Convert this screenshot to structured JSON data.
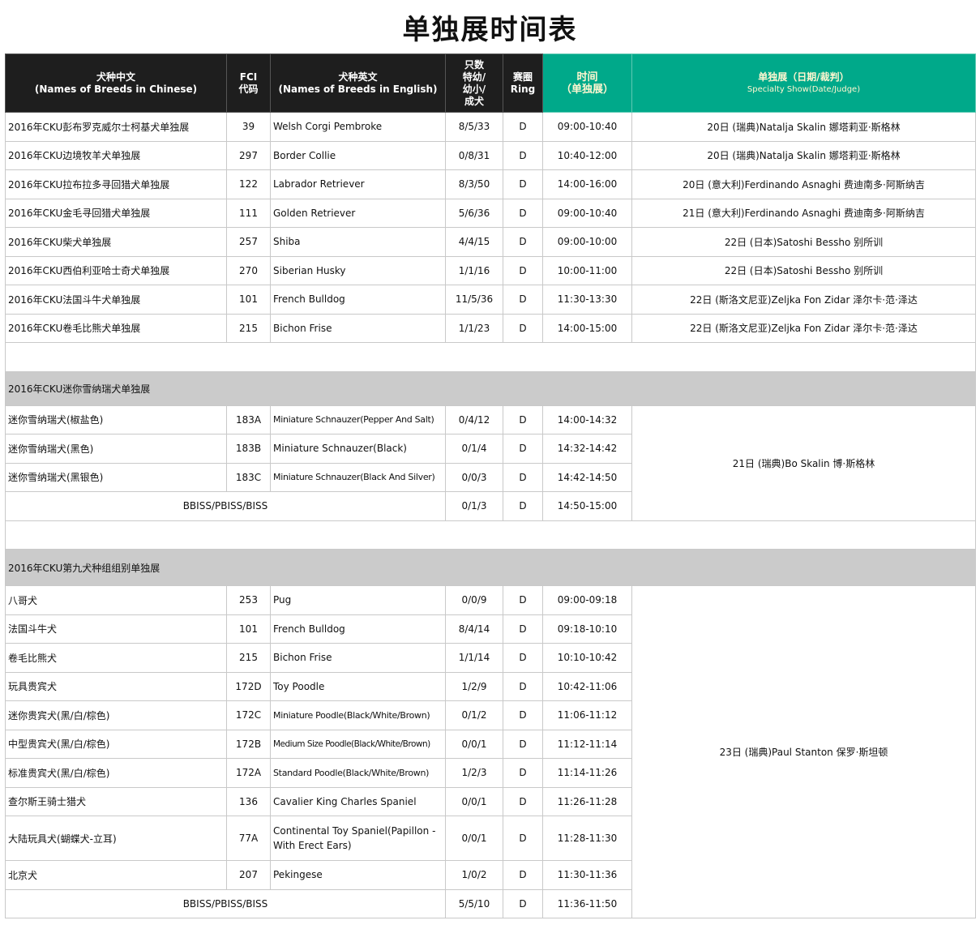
{
  "title": "单独展时间表",
  "header": {
    "breed_cn": "犬种中文",
    "breed_cn_en": "(Names of Breeds in Chinese)",
    "fci": "FCI",
    "fci_code": "代码",
    "breed_en": "犬种英文",
    "breed_en_en": "(Names of Breeds in English)",
    "count_1": "只数",
    "count_2": "特幼/",
    "count_3": "幼小/",
    "count_4": "成犬",
    "ring_cn": "赛圈",
    "ring_en": "Ring",
    "time_cn": "时间",
    "time_sub": "（单独展）",
    "show_cn": "单独展（日期/裁判）",
    "show_en": "Specialty Show(Date/Judge)"
  },
  "section1": {
    "rows": [
      {
        "cn": "2016年CKU彭布罗克威尔士柯基犬单独展",
        "fci": "39",
        "en": "Welsh Corgi Pembroke",
        "count": "8/5/33",
        "ring": "D",
        "time": "09:00-10:40",
        "judge": "20日 (瑞典)Natalja Skalin 娜塔莉亚·斯格林"
      },
      {
        "cn": "2016年CKU边境牧羊犬单独展",
        "fci": "297",
        "en": "Border Collie",
        "count": "0/8/31",
        "ring": "D",
        "time": "10:40-12:00",
        "judge": "20日 (瑞典)Natalja Skalin 娜塔莉亚·斯格林"
      },
      {
        "cn": "2016年CKU拉布拉多寻回猎犬单独展",
        "fci": "122",
        "en": "Labrador Retriever",
        "count": "8/3/50",
        "ring": "D",
        "time": "14:00-16:00",
        "judge": "20日 (意大利)Ferdinando Asnaghi 费迪南多·阿斯纳吉"
      },
      {
        "cn": "2016年CKU金毛寻回猎犬单独展",
        "fci": "111",
        "en": "Golden Retriever",
        "count": "5/6/36",
        "ring": "D",
        "time": "09:00-10:40",
        "judge": "21日 (意大利)Ferdinando Asnaghi 费迪南多·阿斯纳吉"
      },
      {
        "cn": "2016年CKU柴犬单独展",
        "fci": "257",
        "en": "Shiba",
        "count": "4/4/15",
        "ring": "D",
        "time": "09:00-10:00",
        "judge": "22日 (日本)Satoshi Bessho 别所训"
      },
      {
        "cn": "2016年CKU西伯利亚哈士奇犬单独展",
        "fci": "270",
        "en": "Siberian Husky",
        "count": "1/1/16",
        "ring": "D",
        "time": "10:00-11:00",
        "judge": "22日 (日本)Satoshi Bessho 别所训"
      },
      {
        "cn": "2016年CKU法国斗牛犬单独展",
        "fci": "101",
        "en": "French Bulldog",
        "count": "11/5/36",
        "ring": "D",
        "time": "11:30-13:30",
        "judge": "22日 (斯洛文尼亚)Zeljka Fon Zidar 泽尔卡·范·泽达"
      },
      {
        "cn": "2016年CKU卷毛比熊犬单独展",
        "fci": "215",
        "en": "Bichon Frise",
        "count": "1/1/23",
        "ring": "D",
        "time": "14:00-15:00",
        "judge": "22日 (斯洛文尼亚)Zeljka Fon Zidar 泽尔卡·范·泽达"
      }
    ]
  },
  "section2": {
    "title": "2016年CKU迷你雪纳瑞犬单独展",
    "judge": "21日 (瑞典)Bo Skalin 博·斯格林",
    "rows": [
      {
        "cn": "迷你雪纳瑞犬(椒盐色)",
        "fci": "183A",
        "en": "Miniature Schnauzer(Pepper And Salt)",
        "count": "0/4/12",
        "ring": "D",
        "time": "14:00-14:32"
      },
      {
        "cn": "迷你雪纳瑞犬(黑色)",
        "fci": "183B",
        "en": "Miniature Schnauzer(Black)",
        "count": "0/1/4",
        "ring": "D",
        "time": "14:32-14:42"
      },
      {
        "cn": "迷你雪纳瑞犬(黑银色)",
        "fci": "183C",
        "en": "Miniature Schnauzer(Black And Silver)",
        "count": "0/0/3",
        "ring": "D",
        "time": "14:42-14:50"
      }
    ],
    "total": {
      "label": "BBISS/PBISS/BISS",
      "count": "0/1/3",
      "ring": "D",
      "time": "14:50-15:00"
    }
  },
  "section3": {
    "title": "2016年CKU第九犬种组组别单独展",
    "judge": "23日 (瑞典)Paul Stanton 保罗·斯坦顿",
    "rows": [
      {
        "cn": "八哥犬",
        "fci": "253",
        "en": "Pug",
        "count": "0/0/9",
        "ring": "D",
        "time": "09:00-09:18"
      },
      {
        "cn": "法国斗牛犬",
        "fci": "101",
        "en": "French Bulldog",
        "count": "8/4/14",
        "ring": "D",
        "time": "09:18-10:10"
      },
      {
        "cn": "卷毛比熊犬",
        "fci": "215",
        "en": "Bichon Frise",
        "count": "1/1/14",
        "ring": "D",
        "time": "10:10-10:42"
      },
      {
        "cn": "玩具贵宾犬",
        "fci": "172D",
        "en": "Toy Poodle",
        "count": "1/2/9",
        "ring": "D",
        "time": "10:42-11:06"
      },
      {
        "cn": "迷你贵宾犬(黑/白/棕色)",
        "fci": "172C",
        "en": "Miniature Poodle(Black/White/Brown)",
        "count": "0/1/2",
        "ring": "D",
        "time": "11:06-11:12"
      },
      {
        "cn": "中型贵宾犬(黑/白/棕色)",
        "fci": "172B",
        "en": "Medium Size Poodle(Black/White/Brown)",
        "count": "0/0/1",
        "ring": "D",
        "time": "11:12-11:14"
      },
      {
        "cn": "标准贵宾犬(黑/白/棕色)",
        "fci": "172A",
        "en": "Standard Poodle(Black/White/Brown)",
        "count": "1/2/3",
        "ring": "D",
        "time": "11:14-11:26"
      },
      {
        "cn": "查尔斯王骑士猎犬",
        "fci": "136",
        "en": "Cavalier King Charles Spaniel",
        "count": "0/0/1",
        "ring": "D",
        "time": "11:26-11:28"
      },
      {
        "cn": "大陆玩具犬(蝴蝶犬-立耳)",
        "fci": "77A",
        "en": "Continental Toy Spaniel(Papillon - With Erect Ears)",
        "count": "0/0/1",
        "ring": "D",
        "time": "11:28-11:30"
      },
      {
        "cn": "北京犬",
        "fci": "207",
        "en": "Pekingese",
        "count": "1/0/2",
        "ring": "D",
        "time": "11:30-11:36"
      }
    ],
    "total": {
      "label": "BBISS/PBISS/BISS",
      "count": "5/5/10",
      "ring": "D",
      "time": "11:36-11:50"
    }
  }
}
